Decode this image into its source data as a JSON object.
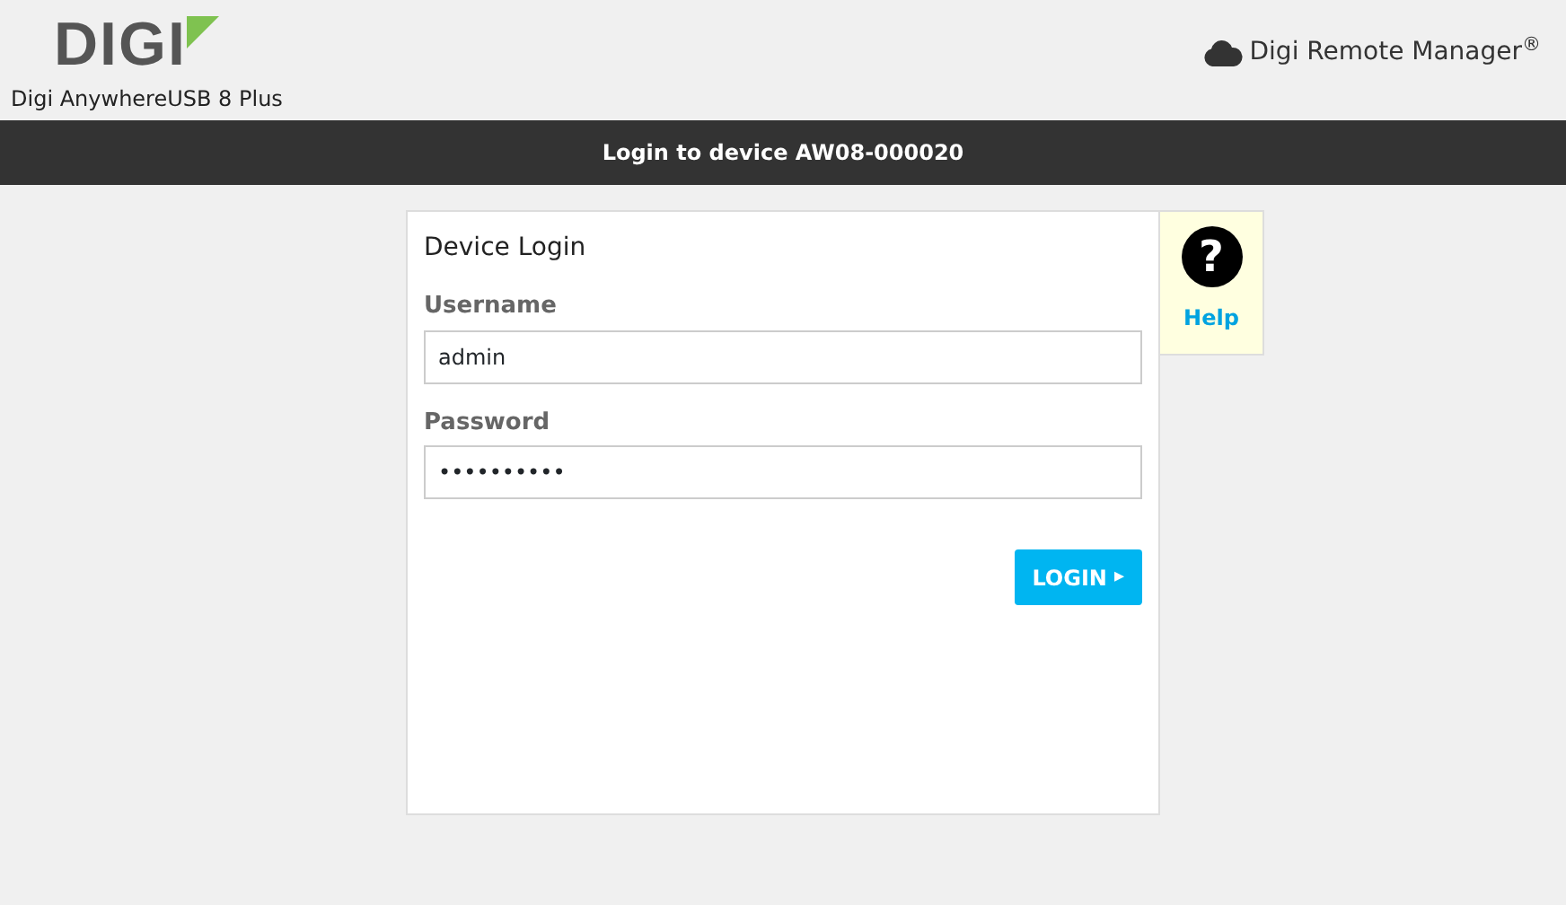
{
  "header": {
    "logo": "DIGI",
    "device_name": "Digi AnywhereUSB 8 Plus",
    "remote_manager": "Digi Remote Manager",
    "remote_manager_mark": "®"
  },
  "title_bar": "Login to device AW08-000020",
  "login": {
    "title": "Device Login",
    "fields": [
      {
        "label": "Username",
        "value": "admin"
      },
      {
        "label": "Password",
        "value": "••••••••••"
      }
    ],
    "button": {
      "label": "LOGIN",
      "arrow": "▸"
    }
  },
  "help": {
    "icon": "?",
    "label": "Help"
  }
}
